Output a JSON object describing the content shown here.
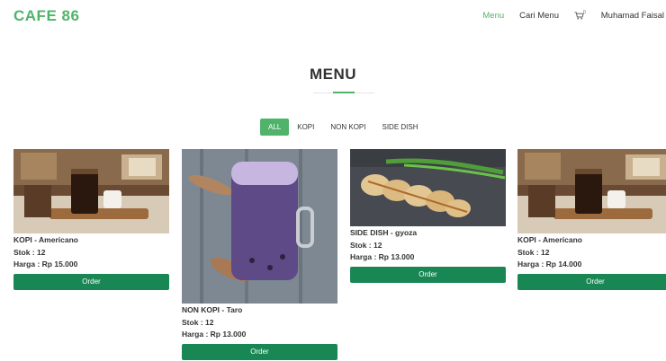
{
  "header": {
    "brand": "CAFE 86",
    "nav": {
      "menu": "Menu",
      "search": "Cari Menu",
      "cart_count": "0",
      "user": "Muhamad Faisal"
    }
  },
  "section": {
    "title": "MENU"
  },
  "filters": [
    "ALL",
    "KOPI",
    "NON KOPI",
    "SIDE DISH"
  ],
  "products": [
    {
      "title": "KOPI - Americano",
      "stock": "Stok : 12",
      "price": "Harga : Rp 15.000",
      "button": "Order",
      "image": "iced-coffee-image"
    },
    {
      "title": "NON KOPI - Taro",
      "stock": "Stok : 12",
      "price": "Harga : Rp 13.000",
      "button": "Order",
      "image": "taro-drink-image"
    },
    {
      "title": "SIDE DISH - gyoza",
      "stock": "Stok : 12",
      "price": "Harga : Rp 13.000",
      "button": "Order",
      "image": "gyoza-image"
    },
    {
      "title": "KOPI - Americano",
      "stock": "Stok : 12",
      "price": "Harga : Rp 14.000",
      "button": "Order",
      "image": "iced-coffee-image"
    }
  ],
  "colors": {
    "accent": "#4fb46a",
    "order_button": "#198754"
  }
}
